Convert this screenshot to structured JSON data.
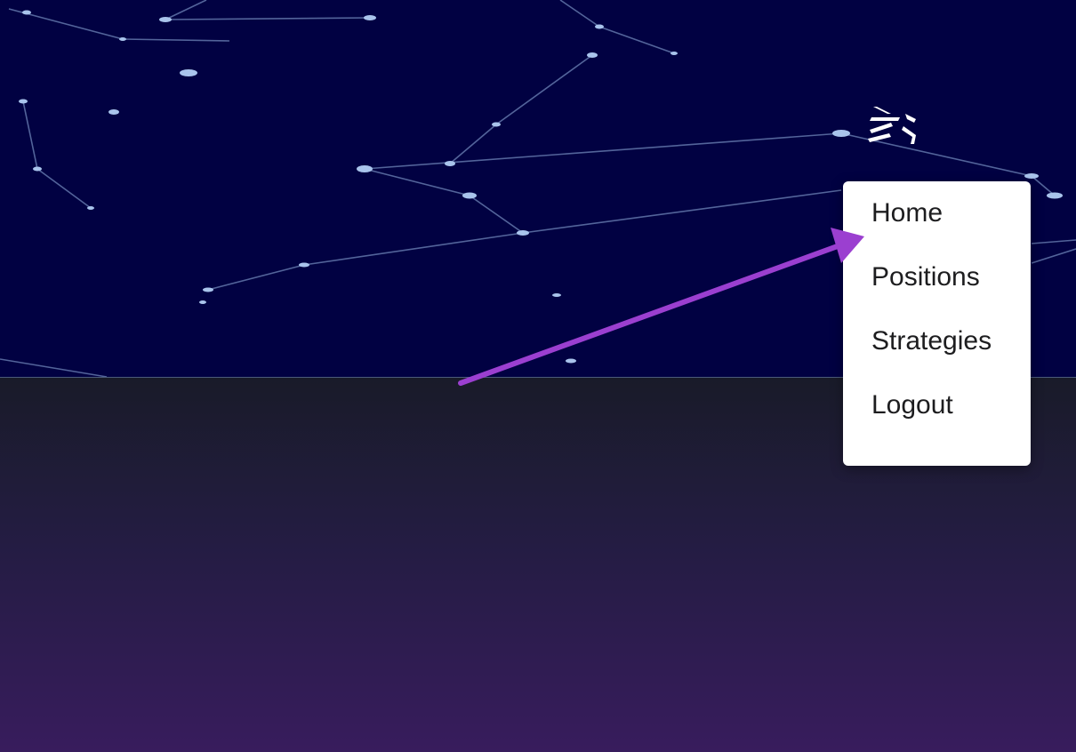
{
  "header": {
    "menu_icon": "menu-collapse-icon"
  },
  "dropdown": {
    "items": [
      {
        "label": "Home"
      },
      {
        "label": "Positions"
      },
      {
        "label": "Strategies"
      },
      {
        "label": "Logout"
      }
    ]
  },
  "annotation": {
    "icon": "arrow-icon",
    "color": "#9b3fd0"
  },
  "colors": {
    "hero_background": "#010142",
    "constellation": "#8aa6d6",
    "gradient_top": "#191b29",
    "gradient_bottom": "#381c5d",
    "menu_background": "#ffffff",
    "menu_text": "#1d1d1f"
  }
}
